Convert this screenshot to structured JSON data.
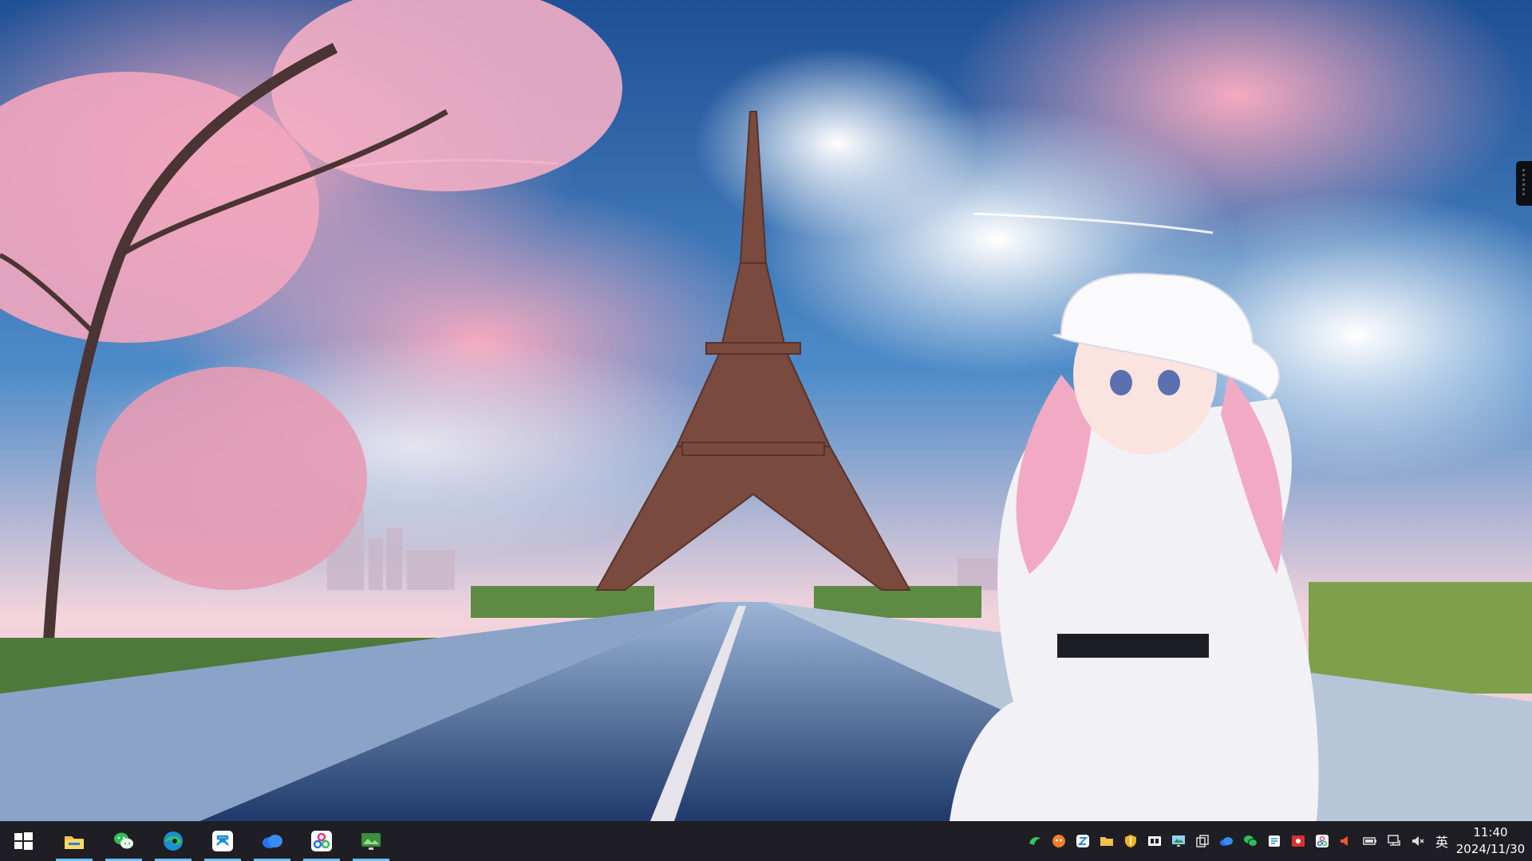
{
  "desktop": {
    "wallpaper_subject": "eiffel-tower-anime-girl-wallpaper"
  },
  "taskbar": {
    "start_icon": "windows-logo-icon",
    "pinned_apps": [
      {
        "icon": "file-explorer-icon",
        "running": true
      },
      {
        "icon": "wechat-icon",
        "running": true
      },
      {
        "icon": "edge-browser-icon",
        "running": true
      },
      {
        "icon": "cloud-drive-icon",
        "running": true
      },
      {
        "icon": "baidu-netdisk-icon",
        "running": true
      },
      {
        "icon": "network-icon",
        "running": true
      },
      {
        "icon": "remote-desktop-icon",
        "running": true
      }
    ],
    "tray_icons": [
      "green-app-icon",
      "orange-app-icon",
      "blue-app-icon",
      "folder-icon",
      "security-shield-icon",
      "media-icon",
      "screen-icon",
      "copy-icon",
      "cloud-icon",
      "wechat-tray-icon",
      "document-icon",
      "red-app-icon",
      "network-tray-icon",
      "speaker-alert-icon",
      "battery-icon",
      "network-monitor-icon",
      "volume-muted-icon"
    ],
    "ime_label": "英",
    "clock": {
      "time": "11:40",
      "date": "2024/11/30"
    }
  },
  "colors": {
    "taskbar_bg": "#1e1e24",
    "running_indicator": "#6cc0f5"
  }
}
